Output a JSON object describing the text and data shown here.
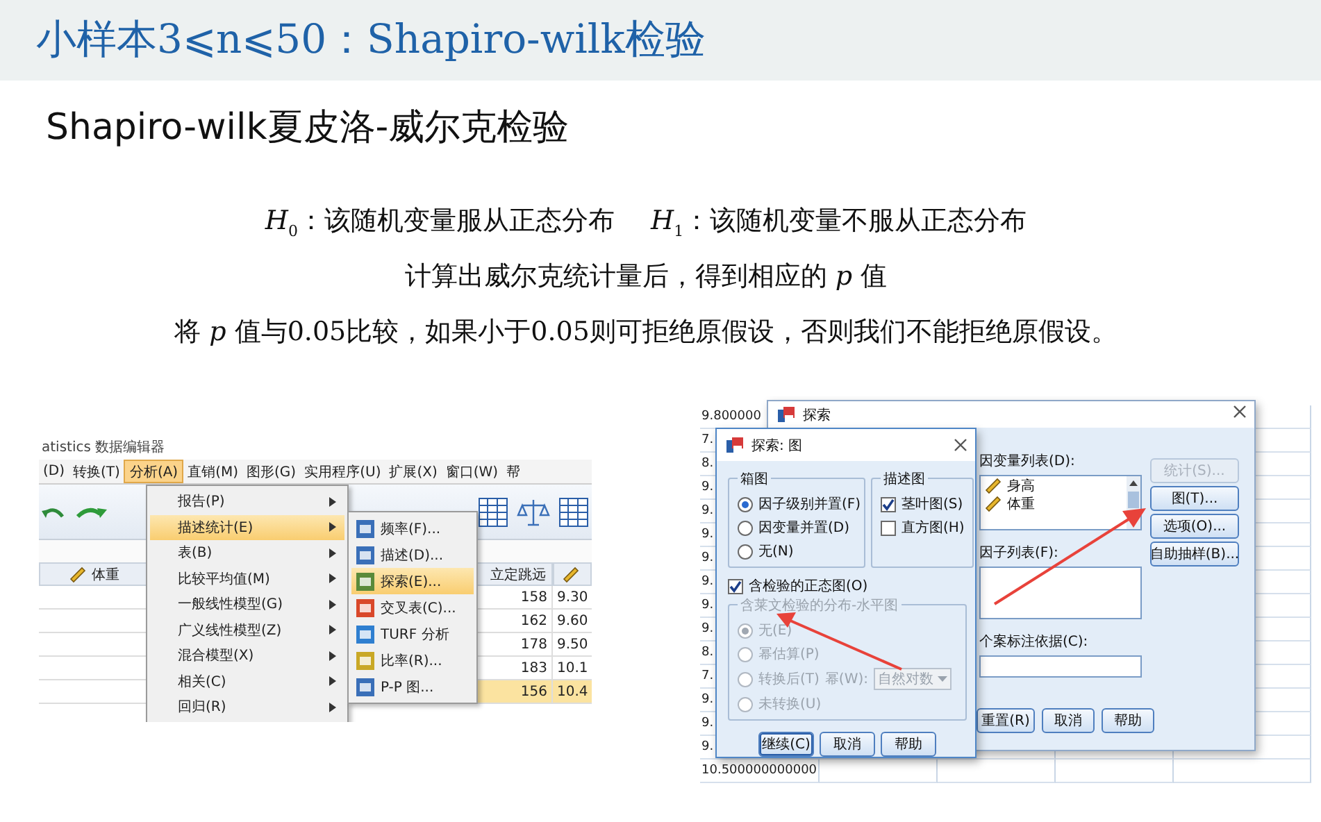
{
  "header": {
    "title": "小样本3⩽n⩽50：Shapiro-wilk检验"
  },
  "subtitle": "Shapiro-wilk夏皮洛-威尔克检验",
  "hypotheses": [
    "*H*$_{0}$：该随机变量服从正态分布",
    "*H*$_{1}$：该随机变量不服从正态分布"
  ],
  "lines": [
    "计算出威尔克统计量后，得到相应的 *p* 值",
    "将 *p* 值与0.05比较，如果小于0.05则可拒绝原假设，否则我们不能拒绝原假设。"
  ],
  "spss_data_editor": {
    "window_title": "atistics 数据编辑器",
    "menubar": [
      {
        "label": "(D)",
        "selected": false
      },
      {
        "label": "转换(T)",
        "selected": false
      },
      {
        "label": "分析(A)",
        "selected": true
      },
      {
        "label": "直销(M)",
        "selected": false
      },
      {
        "label": "图形(G)",
        "selected": false
      },
      {
        "label": "实用程序(U)",
        "selected": false
      },
      {
        "label": "扩展(X)",
        "selected": false
      },
      {
        "label": "窗口(W)",
        "selected": false
      },
      {
        "label": "帮",
        "selected": false
      }
    ],
    "columns": [
      "体重",
      "立定跳远"
    ],
    "menu": [
      {
        "label": "报告(P)",
        "selected": false
      },
      {
        "label": "描述统计(E)",
        "selected": true
      },
      {
        "label": "表(B)",
        "selected": false
      },
      {
        "label": "比较平均值(M)",
        "selected": false
      },
      {
        "label": "一般线性模型(G)",
        "selected": false
      },
      {
        "label": "广义线性模型(Z)",
        "selected": false
      },
      {
        "label": "混合模型(X)",
        "selected": false
      },
      {
        "label": "相关(C)",
        "selected": false
      },
      {
        "label": "回归(R)",
        "selected": false
      }
    ],
    "submenu": [
      {
        "label": "频率(F)...",
        "selected": false
      },
      {
        "label": "描述(D)...",
        "selected": false
      },
      {
        "label": "探索(E)...",
        "selected": true
      },
      {
        "label": "交叉表(C)...",
        "selected": false
      },
      {
        "label": "TURF 分析",
        "selected": false
      },
      {
        "label": "比率(R)...",
        "selected": false
      },
      {
        "label": "P-P 图...",
        "selected": false
      }
    ],
    "rows": [
      {
        "jump": "158",
        "column_4": "9.30",
        "selected": false
      },
      {
        "jump": "162",
        "column_4": "9.60",
        "selected": false
      },
      {
        "jump": "178",
        "column_4": "9.50",
        "selected": false
      },
      {
        "jump": "183",
        "column_4": "10.1",
        "selected": false
      },
      {
        "jump": "156",
        "column_4": "10.4",
        "selected": true
      }
    ]
  },
  "spss_explore": {
    "data_values": [
      "9.800000",
      "7.",
      "8.",
      "9.",
      "9.",
      "9.",
      "9.",
      "9.",
      "9.",
      "9.",
      "8.",
      "7.",
      "9.",
      "9.",
      "9.",
      "10.500000000000"
    ],
    "explore_dialog": {
      "title": "探索",
      "dependent_label": "因变量列表(D):",
      "dependent_items": [
        "身高",
        "体重"
      ],
      "factor_label": "因子列表(F):",
      "label_by": "个案标注依据(C):",
      "side_buttons": [
        {
          "label": "统计(S)...",
          "disabled": true
        },
        {
          "label": "图(T)...",
          "disabled": false
        },
        {
          "label": "选项(O)...",
          "disabled": false
        },
        {
          "label": "自助抽样(B)...",
          "disabled": false
        }
      ],
      "bottom_buttons": [
        "重置(R)",
        "取消",
        "帮助"
      ]
    },
    "plots_dialog": {
      "title": "探索: 图",
      "boxplots": {
        "title": "箱图",
        "options": [
          {
            "label": "因子级别并置(F)",
            "selected": true
          },
          {
            "label": "因变量并置(D)",
            "selected": false
          },
          {
            "label": "无(N)",
            "selected": false
          }
        ]
      },
      "descriptive": {
        "title": "描述图",
        "options": [
          {
            "label": "茎叶图(S)",
            "checked": true
          },
          {
            "label": "直方图(H)",
            "checked": false
          }
        ]
      },
      "normality": {
        "label": "含检验的正态图(O)",
        "checked": true
      },
      "spread_level": {
        "title": "含莱文检验的分布-水平图",
        "disabled": true,
        "options": [
          {
            "label": "无(E)",
            "selected": true
          },
          {
            "label": "幂估算(P)",
            "selected": false
          },
          {
            "label": "转换后(T)",
            "selected": false,
            "power_label": "幂(W):",
            "power_value": "自然对数"
          },
          {
            "label": "未转换(U)",
            "selected": false
          }
        ]
      },
      "buttons": [
        "继续(C)",
        "取消",
        "帮助"
      ]
    }
  }
}
